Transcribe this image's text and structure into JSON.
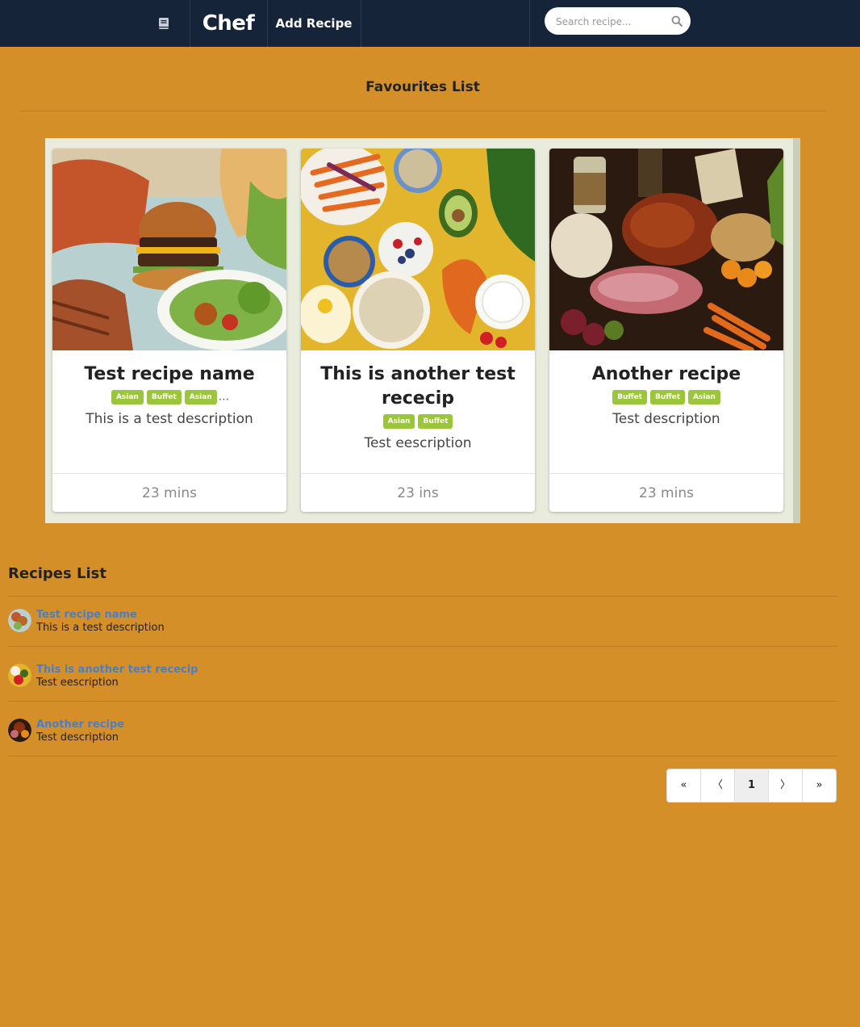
{
  "nav": {
    "icon": "book-icon",
    "brand": "Chef",
    "add_recipe_label": "Add Recipe",
    "search_placeholder": "Search recipe...",
    "search_icon": "search-icon"
  },
  "favourites": {
    "title": "Favourites List",
    "cards": [
      {
        "title": "Test recipe name",
        "tags": [
          "Asian",
          "Buffet",
          "Asian"
        ],
        "more": "...",
        "description": "This is a test description",
        "time": "23 mins",
        "image": "burger-platter-photo"
      },
      {
        "title": "This is another test rececip",
        "tags": [
          "Asian",
          "Buffet"
        ],
        "description": "Test eescription",
        "time": "23 ins",
        "image": "healthy-bowls-photo"
      },
      {
        "title": "Another recipe",
        "tags": [
          "Buffet",
          "Buffet",
          "Asian"
        ],
        "description": "Test description",
        "time": "23 mins",
        "image": "harvest-feast-photo"
      }
    ]
  },
  "recipes_list": {
    "title": "Recipes List",
    "items": [
      {
        "name": "Test recipe name",
        "description": "This is a test description"
      },
      {
        "name": "This is another test rececip",
        "description": "Test eescription"
      },
      {
        "name": "Another recipe",
        "description": "Test description"
      }
    ]
  },
  "pagination": {
    "first": "«",
    "prev": "〈",
    "current": "1",
    "next": "〉",
    "last": "»"
  },
  "colors": {
    "background": "#d58f28",
    "navbar": "#16243a",
    "tag": "#9bc53d",
    "link": "#4a7ec7"
  }
}
